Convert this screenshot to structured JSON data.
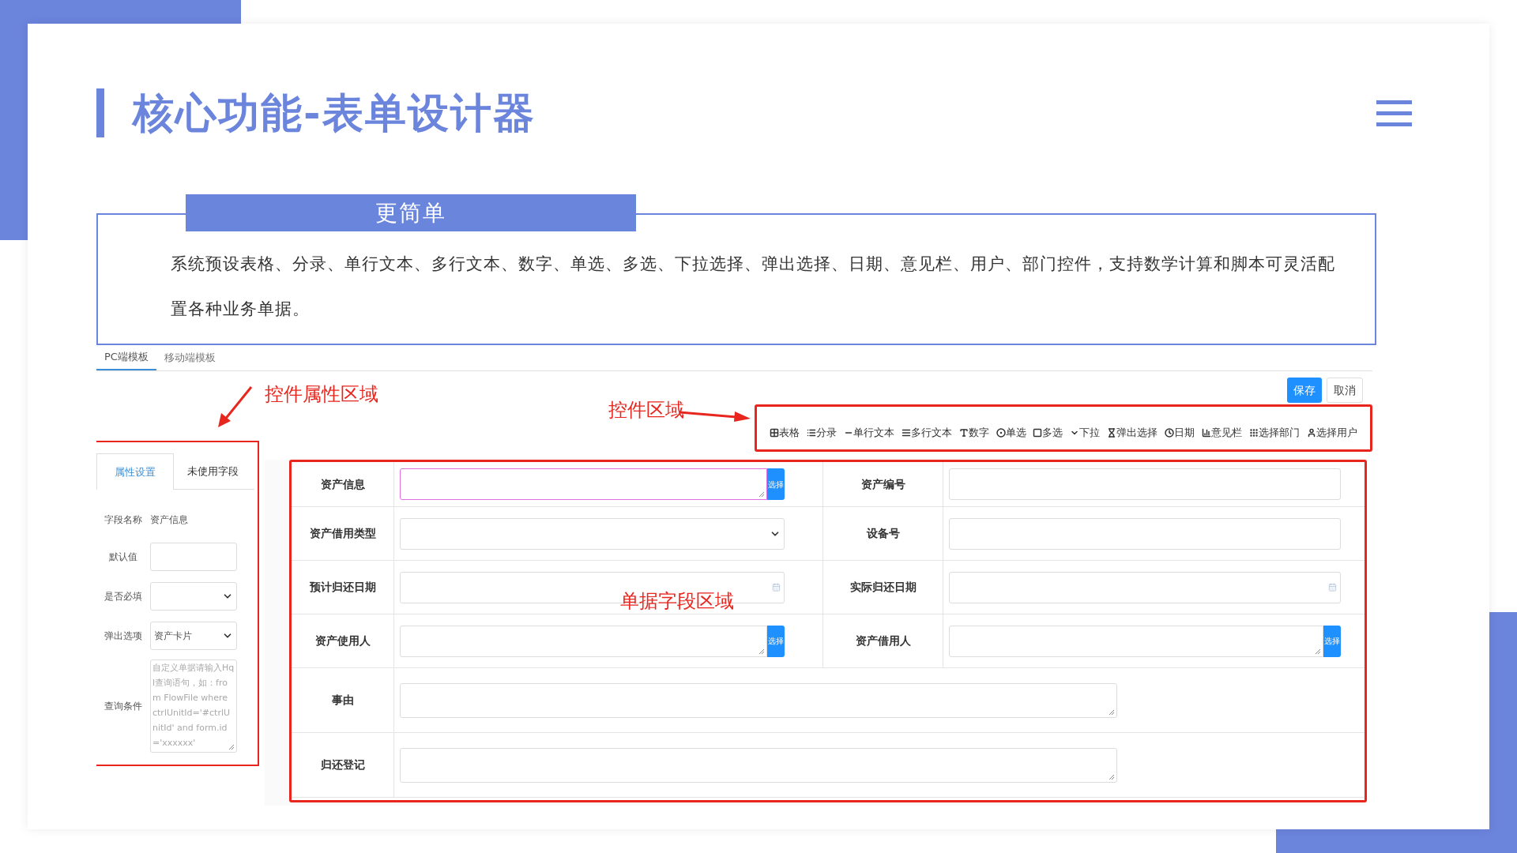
{
  "slide": {
    "title": "核心功能-表单设计器",
    "section_heading": "更简单",
    "paragraph": "系统预设表格、分录、单行文本、多行文本、数字、单选、多选、下拉选择、弹出选择、日期、意见栏、用户、部门控件，支持数学计算和脚本可灵活配置各种业务单据。"
  },
  "screenshot": {
    "tabs": [
      {
        "label": "PC端模板",
        "selected": true
      },
      {
        "label": "移动端模板",
        "selected": false
      }
    ],
    "buttons": [
      {
        "label": "保存",
        "kind": "primary"
      },
      {
        "label": "取消",
        "kind": "default"
      }
    ],
    "annotations": [
      {
        "text": "控件属性区域",
        "kind": "left"
      },
      {
        "text": "控件区域",
        "kind": "right"
      },
      {
        "text": "单据字段区域",
        "kind": "none"
      }
    ],
    "toolbar": [
      {
        "label": "表格",
        "kind": "table"
      },
      {
        "label": "分录",
        "kind": "list"
      },
      {
        "label": "单行文本",
        "kind": "line"
      },
      {
        "label": "多行文本",
        "kind": "lines"
      },
      {
        "label": "数字",
        "kind": "number"
      },
      {
        "label": "单选",
        "kind": "radio"
      },
      {
        "label": "多选",
        "kind": "checkbox"
      },
      {
        "label": "下拉",
        "kind": "dropdown"
      },
      {
        "label": "弹出选择",
        "kind": "popup"
      },
      {
        "label": "日期",
        "kind": "date"
      },
      {
        "label": "意见栏",
        "kind": "opinion"
      },
      {
        "label": "选择部门",
        "kind": "dept"
      },
      {
        "label": "选择用户",
        "kind": "user"
      }
    ],
    "property_panel": {
      "tabs": [
        {
          "label": "属性设置",
          "selected": true
        },
        {
          "label": "未使用字段",
          "selected": false
        }
      ],
      "rows": [
        {
          "kind": "text",
          "label": "字段名称",
          "value": "资产信息"
        },
        {
          "kind": "input",
          "label": "默认值"
        },
        {
          "kind": "select",
          "label": "是否必填"
        },
        {
          "kind": "select",
          "label": "弹出选项",
          "value": "资产卡片"
        },
        {
          "kind": "textarea",
          "label": "查询条件",
          "placeholder": "自定义单据请输入Hql查询语句，如：from FlowFile where ctrlUnitId='#ctrlUnitId' and form.id='xxxxxx'"
        }
      ]
    },
    "form": {
      "rows": [
        {
          "fields": [
            {
              "label": "资产信息",
              "kind": "picker",
              "button": "选择",
              "focused": true
            },
            {
              "label": "资产编号",
              "kind": "input",
              "focused": false
            }
          ]
        },
        {
          "fields": [
            {
              "label": "资产借用类型",
              "kind": "select",
              "focused": false
            },
            {
              "label": "设备号",
              "kind": "input",
              "focused": false
            }
          ]
        },
        {
          "fields": [
            {
              "label": "预计归还日期",
              "kind": "date",
              "focused": false
            },
            {
              "label": "实际归还日期",
              "kind": "date",
              "focused": false
            }
          ]
        },
        {
          "fields": [
            {
              "label": "资产使用人",
              "kind": "picker",
              "button": "选择",
              "focused": false
            },
            {
              "label": "资产借用人",
              "kind": "picker",
              "button": "选择",
              "focused": false
            }
          ]
        },
        {
          "fields": [
            {
              "label": "事由",
              "kind": "textarea",
              "focused": false
            }
          ]
        },
        {
          "fields": [
            {
              "label": "归还登记",
              "kind": "textarea",
              "focused": false
            }
          ]
        }
      ]
    }
  }
}
